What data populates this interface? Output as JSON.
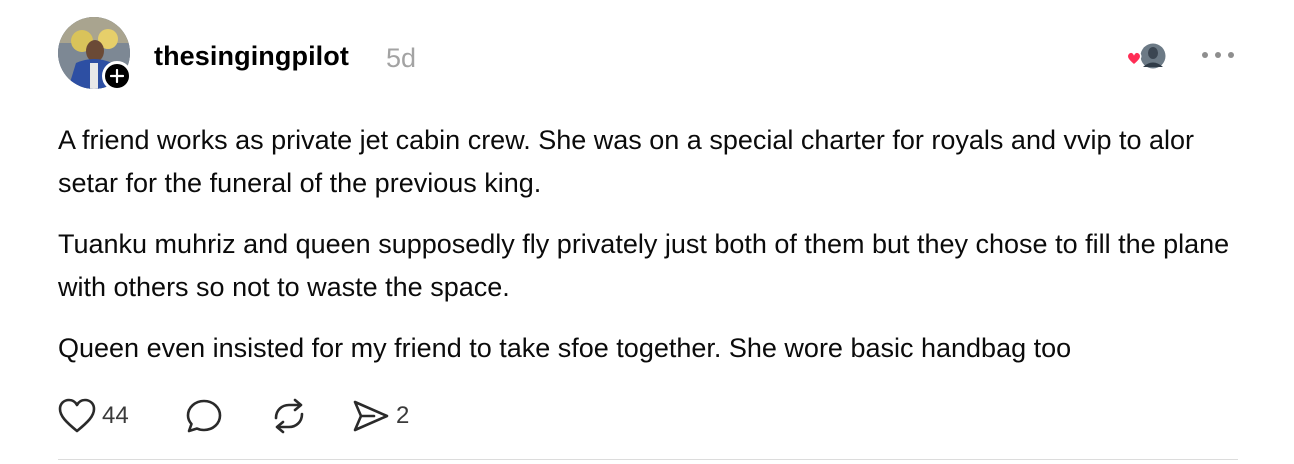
{
  "post": {
    "username": "thesingingpilot",
    "timestamp": "5d",
    "paragraphs": [
      "A friend works as private jet cabin crew. She was on a special charter for royals and vvip to alor setar for the funeral of the previous king.",
      "Tuanku muhriz and queen supposedly fly privately just both of them but they chose to fill the plane with others so not to waste the space.",
      "Queen even insisted for my friend to take sfoe together. She wore basic handbag too"
    ],
    "likes": "44",
    "comments": "",
    "reposts": "",
    "shares": "2"
  },
  "icons": {
    "avatar": "profile-photo",
    "follow": "plus-icon",
    "reply_avatars": "mini-avatar-with-heart",
    "more": "ellipsis-icon",
    "like": "heart-icon",
    "comment": "comment-bubble-icon",
    "repost": "repost-icon",
    "share": "send-icon"
  },
  "colors": {
    "timestamp": "#a3a3a3",
    "heart_badge": "#ff2d55",
    "text": "#0b0b0b",
    "divider": "#dcdcdc"
  }
}
